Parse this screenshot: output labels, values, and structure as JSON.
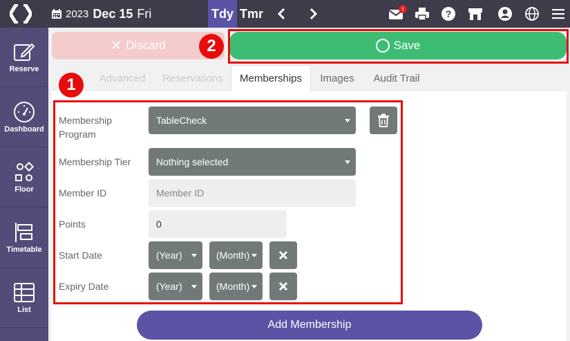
{
  "header": {
    "year": "2023",
    "month_day": "Dec 15",
    "weekday": "Fri",
    "today_label": "Tdy",
    "tomorrow_label": "Tmr",
    "notification_count": "!"
  },
  "sidebar": {
    "items": [
      {
        "label": "Reserve",
        "icon": "edit-icon"
      },
      {
        "label": "Dashboard",
        "icon": "gauge-icon"
      },
      {
        "label": "Floor",
        "icon": "shapes-icon"
      },
      {
        "label": "Timetable",
        "icon": "timetable-icon"
      },
      {
        "label": "List",
        "icon": "table-icon"
      }
    ]
  },
  "actions": {
    "discard_label": "Discard",
    "save_label": "Save"
  },
  "tabs": [
    {
      "label": "Advanced",
      "state": "faded"
    },
    {
      "label": "Reservations",
      "state": "faded"
    },
    {
      "label": "Memberships",
      "state": "active"
    },
    {
      "label": "Images",
      "state": "normal"
    },
    {
      "label": "Audit Trail",
      "state": "normal"
    }
  ],
  "form": {
    "program_label": "Membership\nProgram",
    "program_value": "TableCheck",
    "tier_label": "Membership Tier",
    "tier_value": "Nothing selected",
    "member_id_label": "Member ID",
    "member_id_placeholder": "Member ID",
    "points_label": "Points",
    "points_value": "0",
    "start_date_label": "Start Date",
    "expiry_date_label": "Expiry Date",
    "year_placeholder": "(Year)",
    "month_placeholder": "(Month)"
  },
  "add_membership_label": "Add Membership",
  "markers": {
    "one": "1",
    "two": "2"
  },
  "colors": {
    "topbar": "#3e3b4a",
    "sidebar": "#524d78",
    "accent": "#5c53a7",
    "save": "#3dbd73",
    "discard": "#f4cccc",
    "select": "#717a79",
    "highlight": "#e80b0b"
  }
}
